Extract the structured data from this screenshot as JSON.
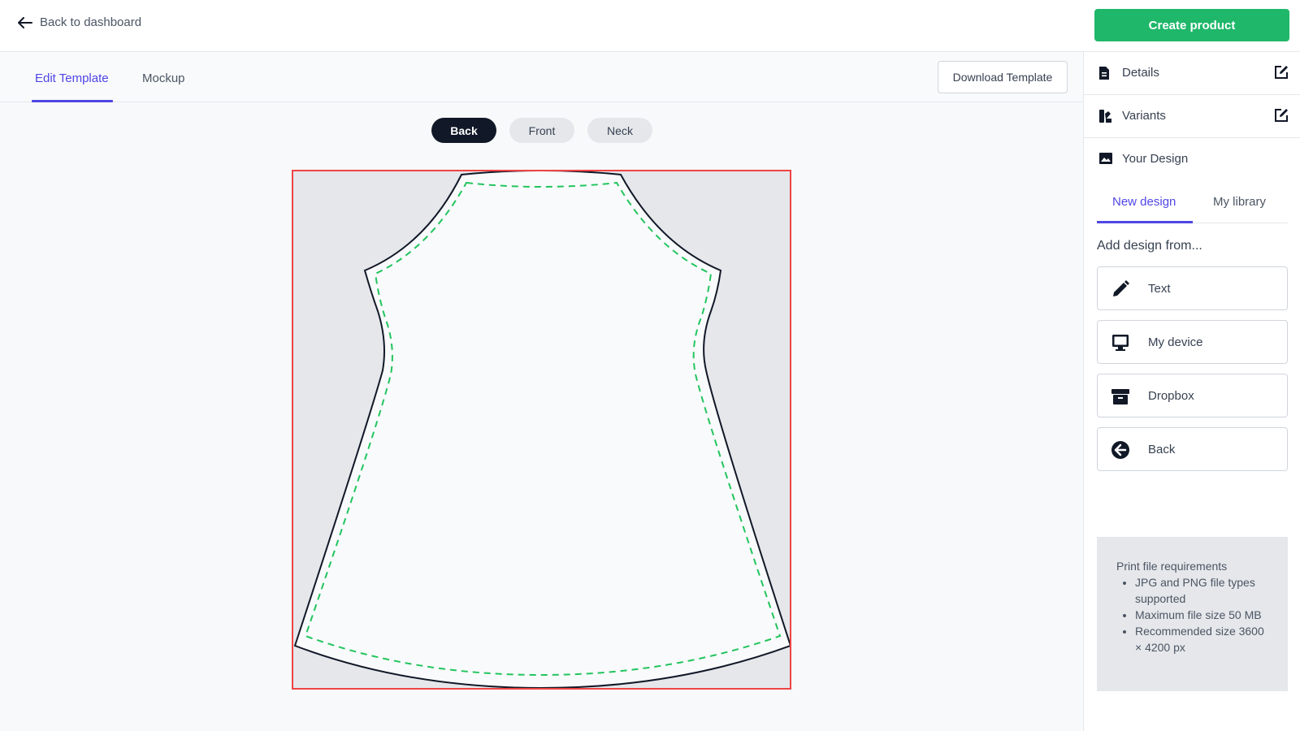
{
  "header": {
    "back_label": "Back to dashboard",
    "create_label": "Create product"
  },
  "editor": {
    "tabs": [
      {
        "label": "Edit Template",
        "active": true
      },
      {
        "label": "Mockup",
        "active": false
      }
    ],
    "download_label": "Download Template",
    "views": [
      {
        "label": "Back",
        "active": true
      },
      {
        "label": "Front",
        "active": false
      },
      {
        "label": "Neck",
        "active": false
      }
    ],
    "colors": {
      "frame_border": "#ef4444",
      "safe_line": "#22c55e",
      "accent": "#4f46e5"
    }
  },
  "sidebar": {
    "sections": [
      {
        "label": "Details",
        "icon": "document-icon"
      },
      {
        "label": "Variants",
        "icon": "swatch-icon"
      },
      {
        "label": "Your Design",
        "icon": "image-icon"
      }
    ],
    "design_tabs": [
      {
        "label": "New design",
        "active": true
      },
      {
        "label": "My library",
        "active": false
      }
    ],
    "add_heading": "Add design from...",
    "sources": [
      {
        "label": "Text",
        "icon": "pencil-icon"
      },
      {
        "label": "My device",
        "icon": "monitor-icon"
      },
      {
        "label": "Dropbox",
        "icon": "archive-icon"
      },
      {
        "label": "Back",
        "icon": "arrow-left-circle-icon"
      }
    ],
    "requirements": {
      "title": "Print file requirements",
      "items": [
        "JPG and PNG file types supported",
        "Maximum file size 50 MB",
        "Recommended size 3600 × 4200 px"
      ]
    }
  }
}
